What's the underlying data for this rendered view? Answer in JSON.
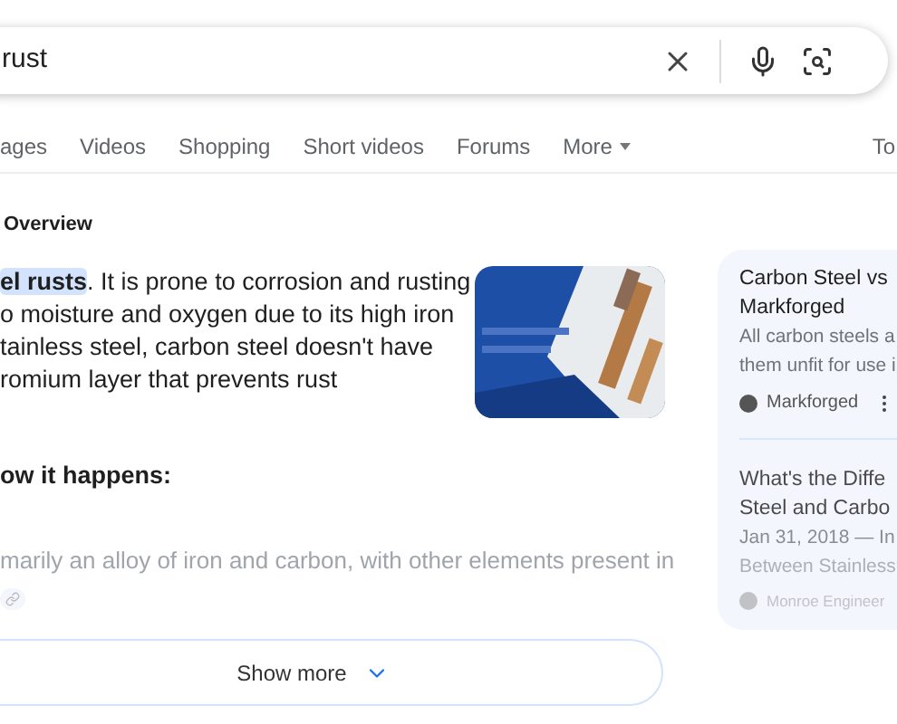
{
  "search": {
    "value": "rust"
  },
  "tabs": [
    {
      "label": "ages",
      "selected": false
    },
    {
      "label": "Videos",
      "selected": false
    },
    {
      "label": "Shopping",
      "selected": false
    },
    {
      "label": "Short videos",
      "selected": false
    },
    {
      "label": "Forums",
      "selected": false
    },
    {
      "label": "More",
      "selected": false
    }
  ],
  "tools": "To",
  "overview": {
    "title": "Overview",
    "lines": [
      "**el rusts**. It is prone to corrosion and rusting",
      "o moisture and oxygen due to its high iron",
      "tainless steel, carbon steel doesn't have",
      "romium layer that prevents rust"
    ],
    "heading": "ow it happens:",
    "faded_line": "marily an alloy of iron and carbon, with other elements present in",
    "show_more": "Show more"
  },
  "sources": [
    {
      "title_lines": [
        "Carbon Steel vs",
        "Markforged"
      ],
      "snippet_lines": [
        "All carbon steels a",
        "them unfit for use i"
      ],
      "site": "Markforged"
    },
    {
      "title_lines": [
        "What's the Diffe",
        "Steel and Carbo"
      ],
      "snippet_lines": [
        "Jan 31, 2018 — In",
        "Between Stainless"
      ],
      "site": "Monroe Engineer"
    }
  ]
}
